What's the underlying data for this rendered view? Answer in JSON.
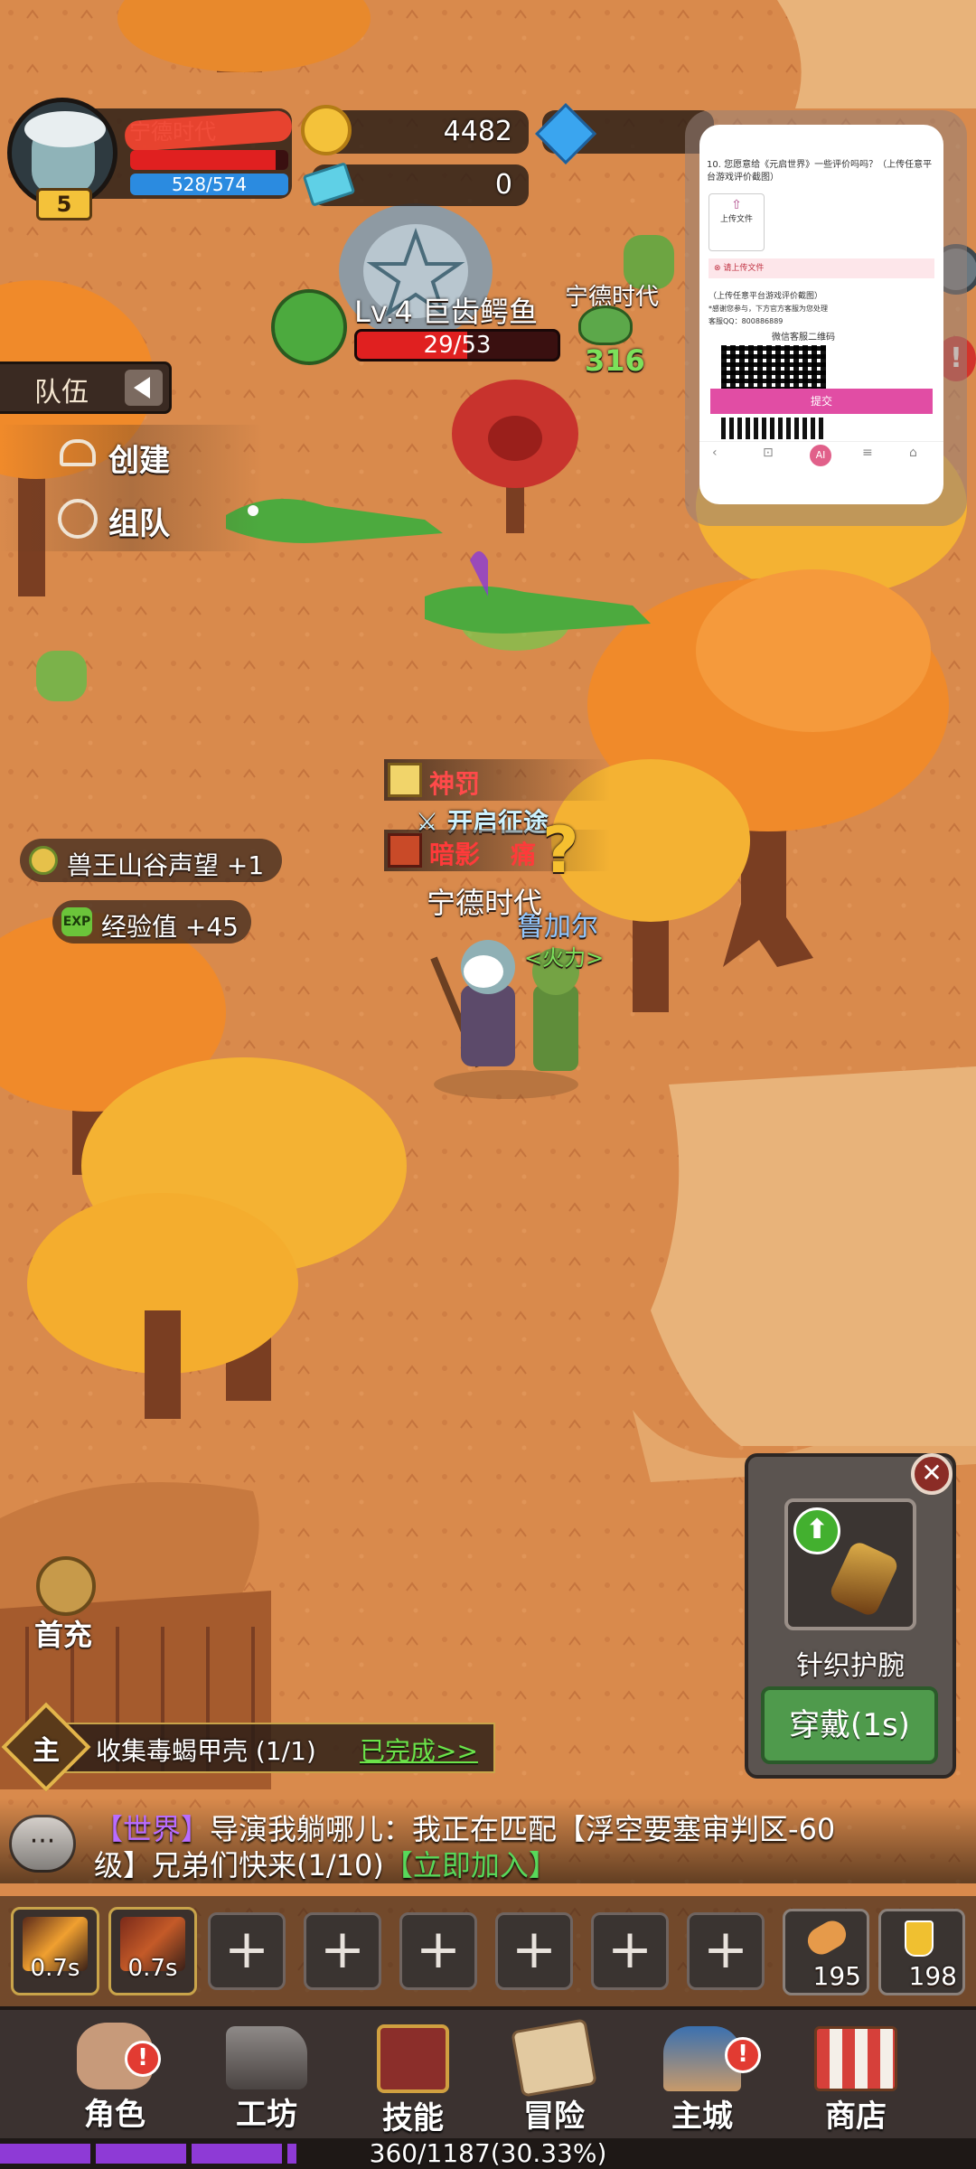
{
  "player": {
    "name": "宁德时代",
    "level": "5",
    "hp_text": "528/574",
    "hp_fraction": 0.92
  },
  "currency": {
    "gold": "4482",
    "ticket": "0"
  },
  "team_panel": {
    "title": "队伍",
    "create": "创建",
    "group": "组队"
  },
  "enemy": {
    "title": "Lv.4 巨齿鳄鱼",
    "hp_text": "29/53",
    "hp_fraction": 0.55,
    "ally_name": "宁德时代",
    "ally_value": "316"
  },
  "notifications": {
    "reputation": "兽王山谷声望 +1",
    "exp": "经验值 +45"
  },
  "buffs": [
    {
      "label": "神罚"
    },
    {
      "label": "开启征途"
    },
    {
      "label": "暗影"
    },
    {
      "label": "痛"
    }
  ],
  "characters": {
    "player_name": "宁德时代",
    "pet_name": "鲁加尔",
    "pet_tag": "<火力>",
    "quest_mark": "?"
  },
  "overlay": {
    "question": "10. 您愿意给《元启世界》一些评价吗吗？（上传任意平台游戏评价截图）",
    "upload": "上传文件",
    "upload_hint": "请上传文件",
    "note": "（上传任意平台游戏评价截图）",
    "desc": "*感谢您参与，下方官方客服为您处理",
    "qq": "客服QQ：800886889",
    "wechat": "微信客服二维码",
    "submit": "提交",
    "ai": "AI"
  },
  "equip_popup": {
    "item_name": "针织护腕",
    "button": "穿戴(1s)"
  },
  "first_charge": "首充",
  "quest": {
    "icon_label": "主",
    "text": "收集毒蝎甲壳 (1/1)",
    "status": "已完成>>"
  },
  "chat": {
    "channel": "【世界】",
    "message": "导演我躺哪儿：我正在匹配【浮空要塞审判区-60级】兄弟们快来(1/10)",
    "join": "【立即加入】"
  },
  "skills": {
    "slot1_cd": "0.7s",
    "slot2_cd": "0.7s",
    "empty_label": "+",
    "item1_count": "195",
    "item2_count": "198"
  },
  "nav": [
    {
      "label": "角色",
      "badge": "!"
    },
    {
      "label": "工坊"
    },
    {
      "label": "技能"
    },
    {
      "label": "冒险"
    },
    {
      "label": "主城",
      "badge": "!"
    },
    {
      "label": "商店"
    }
  ],
  "exp_bar": {
    "text": "360/1187(30.33%)",
    "fraction": 0.3033
  },
  "colors": {
    "ground": "#d98a4c",
    "tree_orange": "#f08a2a",
    "tree_yellow": "#f4b233",
    "trunk": "#7a3e22",
    "hp_red": "#e02020",
    "mp_blue": "#2b8be0",
    "quest_done": "#6be34a",
    "exp_purple": "#8e3ad6",
    "chat_world": "#b86cff",
    "chat_join": "#58d85a",
    "submit_pink": "#e14da4"
  }
}
